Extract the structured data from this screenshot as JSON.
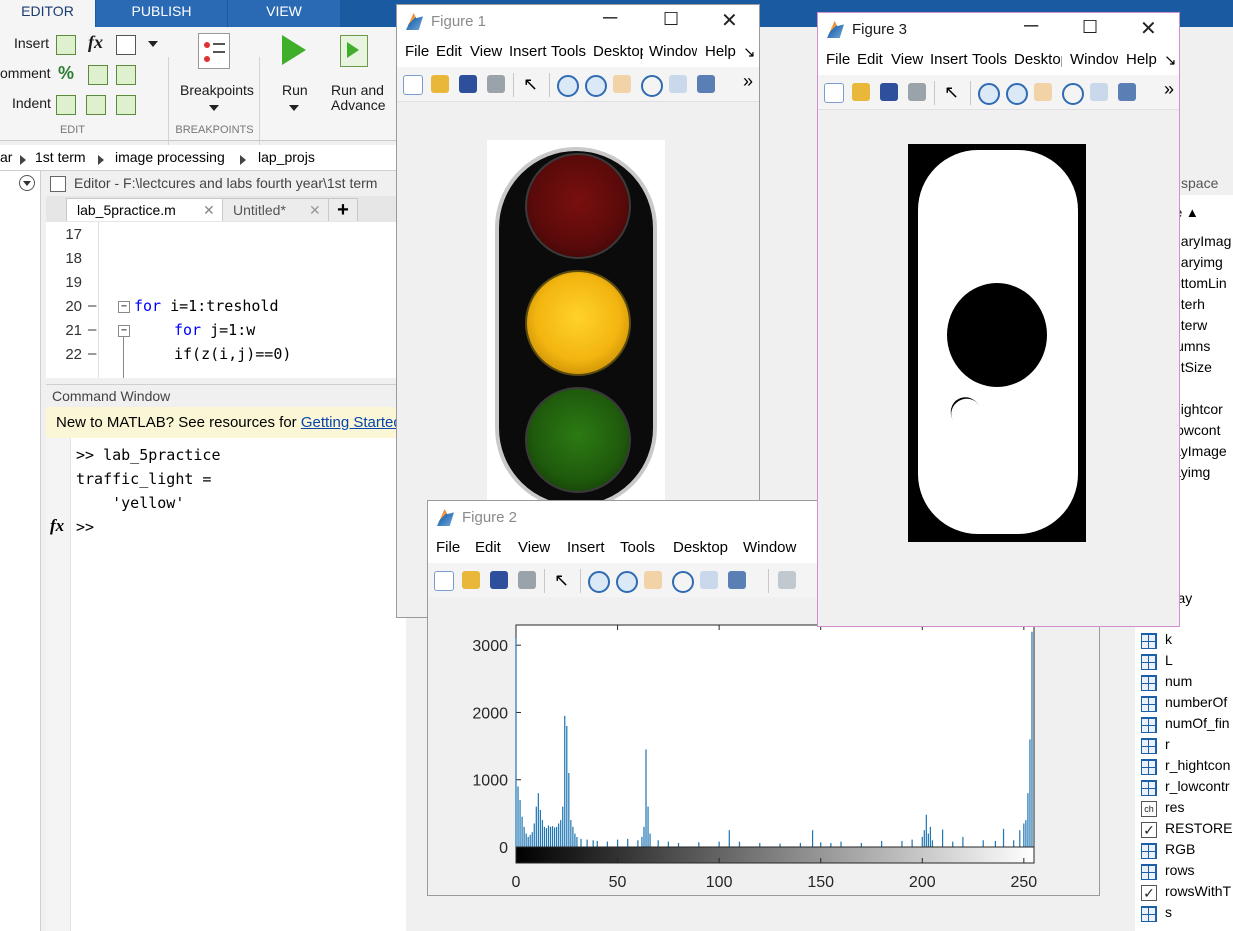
{
  "ribbon": {
    "tabs": [
      "EDITOR",
      "PUBLISH",
      "VIEW"
    ],
    "edit_rows": [
      {
        "label": "Insert",
        "fx": "fx"
      },
      {
        "label": "omment"
      },
      {
        "label": "Indent"
      }
    ],
    "breakpoints_label": "Breakpoints",
    "run_label": "Run",
    "run_advance_label": "Run and",
    "run_advance_label2": "Advance",
    "section_edit": "EDIT",
    "section_breakpoints": "BREAKPOINTS"
  },
  "pathbar": {
    "crumbs": [
      "ar",
      "1st term",
      "image processing",
      "lap_projs"
    ]
  },
  "editor": {
    "title": "Editor - F:\\lectcures and labs fourth year\\1st term",
    "tabs": [
      "lab_5practice.m",
      "Untitled*"
    ],
    "add_tab": "+",
    "close_glyph": "✕",
    "lines": [
      {
        "num": "17",
        "dash": "",
        "code": ""
      },
      {
        "num": "18",
        "dash": "",
        "code": ""
      },
      {
        "num": "19",
        "dash": "",
        "code": ""
      },
      {
        "num": "20",
        "dash": "–",
        "kw": "for",
        "code": " i=1:treshold"
      },
      {
        "num": "21",
        "dash": "–",
        "kw": "for",
        "code": " j=1:w"
      },
      {
        "num": "22",
        "dash": "–",
        "kw": "",
        "code": "if(z(i,j)==0)"
      }
    ]
  },
  "command_window": {
    "title": "Command Window",
    "banner_text": "New to MATLAB? See resources for ",
    "banner_link": "Getting Started",
    "banner_end": ".",
    "lines": [
      ">> lab_5practice",
      "traffic_light =",
      "    'yellow'"
    ],
    "fx_symbol": "fx",
    "prompt": ">>"
  },
  "workspace": {
    "title": "space",
    "sort_label": "e ▲",
    "upper_items": [
      "naryImag",
      "naryimg",
      "ottomLin",
      "nterh",
      "nterw",
      "lumns",
      "ntSize",
      "",
      "hightcor",
      "lowcont",
      "ayImage",
      "ayimg"
    ],
    "gray_label": "gray",
    "items": [
      {
        "name": "k",
        "icon": "grid"
      },
      {
        "name": "L",
        "icon": "grid"
      },
      {
        "name": "num",
        "icon": "grid"
      },
      {
        "name": "numberOf",
        "icon": "grid"
      },
      {
        "name": "numOf_fin",
        "icon": "grid"
      },
      {
        "name": "r",
        "icon": "grid"
      },
      {
        "name": "r_hightcon",
        "icon": "grid"
      },
      {
        "name": "r_lowcontr",
        "icon": "grid"
      },
      {
        "name": "res",
        "icon": "char"
      },
      {
        "name": "RESTORED",
        "icon": "check"
      },
      {
        "name": "RGB",
        "icon": "grid"
      },
      {
        "name": "rows",
        "icon": "grid"
      },
      {
        "name": "rowsWithT",
        "icon": "check"
      },
      {
        "name": "s",
        "icon": "grid"
      }
    ]
  },
  "figures": {
    "fig1": {
      "title": "Figure 1",
      "menu": [
        "File",
        "Edit",
        "View",
        "Insert",
        "Tools",
        "Desktop",
        "Window",
        "Help"
      ]
    },
    "fig2": {
      "title": "Figure 2",
      "menu": [
        "File",
        "Edit",
        "View",
        "Insert",
        "Tools",
        "Desktop",
        "Window"
      ]
    },
    "fig3": {
      "title": "Figure 3",
      "menu": [
        "File",
        "Edit",
        "View",
        "Insert",
        "Tools",
        "Desktop",
        "Window",
        "Help"
      ]
    },
    "more_glyph": "»",
    "dock_glyph": "↘"
  },
  "chart_data": {
    "type": "bar",
    "title": "",
    "xlabel": "",
    "ylabel": "",
    "xlim": [
      0,
      255
    ],
    "ylim": [
      0,
      3000
    ],
    "xticks": [
      0,
      50,
      100,
      150,
      200,
      250
    ],
    "yticks": [
      0,
      1000,
      2000,
      3000
    ],
    "bar_color": "#1f77b4",
    "colorbar": "gray",
    "x": [
      0,
      1,
      2,
      3,
      4,
      5,
      6,
      7,
      8,
      9,
      10,
      11,
      12,
      13,
      14,
      15,
      16,
      17,
      18,
      19,
      20,
      21,
      22,
      23,
      24,
      25,
      26,
      27,
      28,
      29,
      30,
      32,
      35,
      38,
      40,
      45,
      50,
      55,
      60,
      62,
      63,
      64,
      65,
      66,
      70,
      75,
      80,
      90,
      100,
      105,
      110,
      120,
      130,
      140,
      146,
      150,
      155,
      160,
      170,
      180,
      190,
      195,
      200,
      201,
      202,
      203,
      204,
      205,
      210,
      215,
      220,
      230,
      236,
      240,
      245,
      248,
      250,
      251,
      252,
      253,
      254,
      255
    ],
    "values": [
      3100,
      900,
      700,
      450,
      300,
      200,
      150,
      180,
      220,
      350,
      600,
      800,
      550,
      400,
      300,
      280,
      320,
      300,
      310,
      290,
      300,
      350,
      400,
      600,
      1950,
      1800,
      1100,
      400,
      300,
      200,
      150,
      120,
      110,
      100,
      90,
      80,
      110,
      120,
      100,
      150,
      300,
      1450,
      600,
      200,
      100,
      80,
      60,
      70,
      80,
      250,
      80,
      60,
      50,
      60,
      250,
      70,
      60,
      80,
      60,
      90,
      90,
      110,
      150,
      250,
      480,
      200,
      300,
      100,
      260,
      80,
      150,
      100,
      90,
      270,
      100,
      250,
      350,
      400,
      800,
      1600,
      3200
    ]
  }
}
